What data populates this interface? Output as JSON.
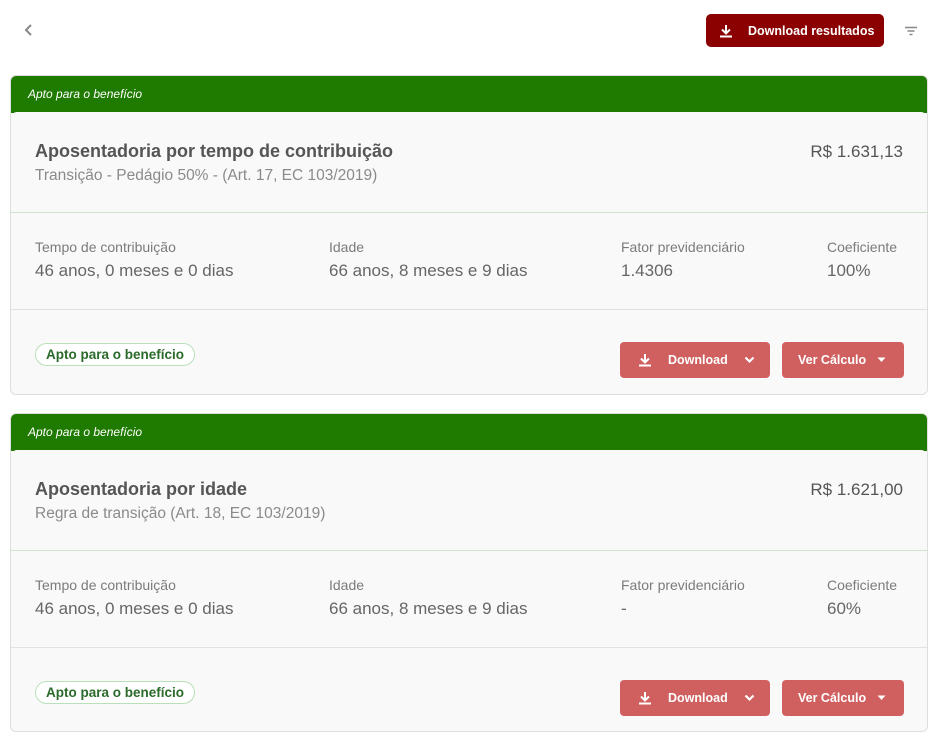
{
  "toolbar": {
    "download_all_label": "Download resultados",
    "back_icon": "chevron-left-icon",
    "filter_icon": "filter-icon"
  },
  "colors": {
    "header_green": "#1f7a00",
    "download_all_bg": "#8b0000",
    "action_button_bg": "#d05f5f",
    "badge_text": "#2a6a2a"
  },
  "cards": [
    {
      "header": "Apto para o benefício",
      "title": "Aposentadoria por tempo de contribuição",
      "subtitle": "Transição - Pedágio 50% - (Art. 17, EC 103/2019)",
      "value": "R$ 1.631,13",
      "stats": [
        {
          "label": "Tempo de contribuição",
          "value": "46 anos, 0 meses e 0 dias"
        },
        {
          "label": "Idade",
          "value": "66 anos, 8 meses e 9 dias"
        },
        {
          "label": "Fator previdenciário",
          "value": "1.4306"
        },
        {
          "label": "Coeficiente",
          "value": "100%"
        }
      ],
      "badge": "Apto para o benefício",
      "download_label": "Download",
      "calc_label": "Ver Cálculo"
    },
    {
      "header": "Apto para o benefício",
      "title": "Aposentadoria por idade",
      "subtitle": "Regra de transição (Art. 18, EC 103/2019)",
      "value": "R$ 1.621,00",
      "stats": [
        {
          "label": "Tempo de contribuição",
          "value": "46 anos, 0 meses e 0 dias"
        },
        {
          "label": "Idade",
          "value": "66 anos, 8 meses e 9 dias"
        },
        {
          "label": "Fator previdenciário",
          "value": "-"
        },
        {
          "label": "Coeficiente",
          "value": "60%"
        }
      ],
      "badge": "Apto para o benefício",
      "download_label": "Download",
      "calc_label": "Ver Cálculo"
    }
  ]
}
